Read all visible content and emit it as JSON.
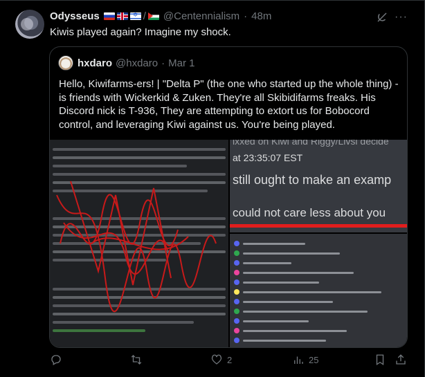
{
  "post": {
    "display_name": "Odysseus",
    "flags": [
      "flag-russia",
      "flag-uk",
      "flag-israel",
      "flag-palestine"
    ],
    "flag_separator": "/",
    "handle": "@Centennialism",
    "dot": "·",
    "time": "48m",
    "text": "Kiwis played again? Imagine my shock."
  },
  "quote": {
    "display_name": "hxdaro",
    "handle": "@hxdaro",
    "dot": "·",
    "date": "Mar 1",
    "text": "Hello, Kiwifarms-ers! | \"Delta P\" (the one who started up the whole thing) - is friends with Wickerkid & Zuken. They're all Skibidifarms freaks. His Discord nick is T-936, They are attempting to extort us for Bobocord control, and leveraging Kiwi against us. You're being played.",
    "media": {
      "right_top_lines": [
        "ixxed on Kiwi and Riggy/Livsi decide",
        "at 23:35:07 EST",
        "still ought to make an examp",
        "could not care less about you"
      ]
    }
  },
  "actions": {
    "reply_count": "",
    "repost_count": "",
    "like_count": "2",
    "views_count": "25"
  },
  "colors": {
    "background": "#000000",
    "text": "#e7e9ea",
    "muted": "#71767b",
    "border": "#2f3336",
    "scribble": "#c81a1a"
  }
}
